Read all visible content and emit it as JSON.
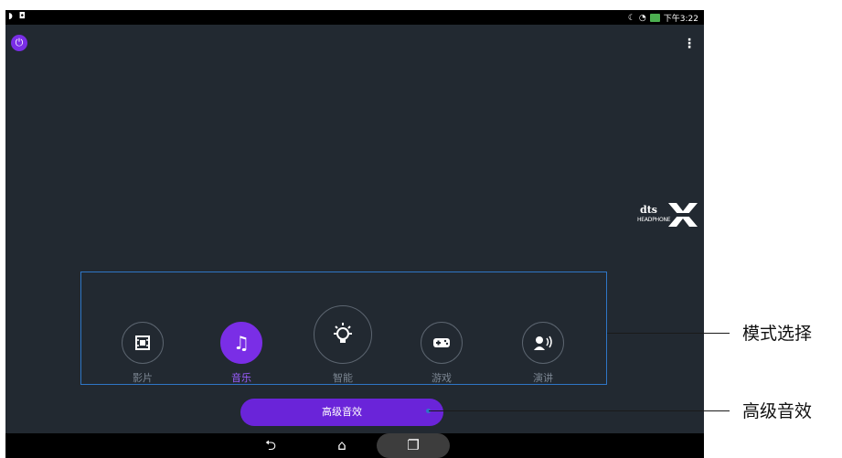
{
  "status_bar": {
    "left_icons": "◗ ◘",
    "moon_icon": "☾",
    "wifi_icon": "◔",
    "time": "下午3:22"
  },
  "top_bar": {
    "power_icon": "⏻",
    "menu_icon": "⋮"
  },
  "logo": {
    "line1": "dts",
    "line2": "HEADPHONE"
  },
  "modes": [
    {
      "label": "影片",
      "icon": "film-icon",
      "glyph": "🎞",
      "selected": false
    },
    {
      "label": "音乐",
      "icon": "music-note-icon",
      "glyph": "♫",
      "selected": true
    },
    {
      "label": "智能",
      "icon": "light-bulb-icon",
      "glyph": "💡",
      "selected": false
    },
    {
      "label": "游戏",
      "icon": "gamepad-icon",
      "glyph": "🎮",
      "selected": false
    },
    {
      "label": "演讲",
      "icon": "speaker-person-icon",
      "glyph": "🗣",
      "selected": false
    }
  ],
  "advanced_button": {
    "label": "高级音效"
  },
  "nav_bar": {
    "back_icon": "⮌",
    "home_icon": "⌂",
    "recent_icon": "❐"
  },
  "callouts": {
    "mode_select": "模式选择",
    "advanced_sound": "高级音效"
  },
  "colors": {
    "accent": "#7a2ee6",
    "background": "#222931",
    "callout_border": "#2e76c6"
  }
}
